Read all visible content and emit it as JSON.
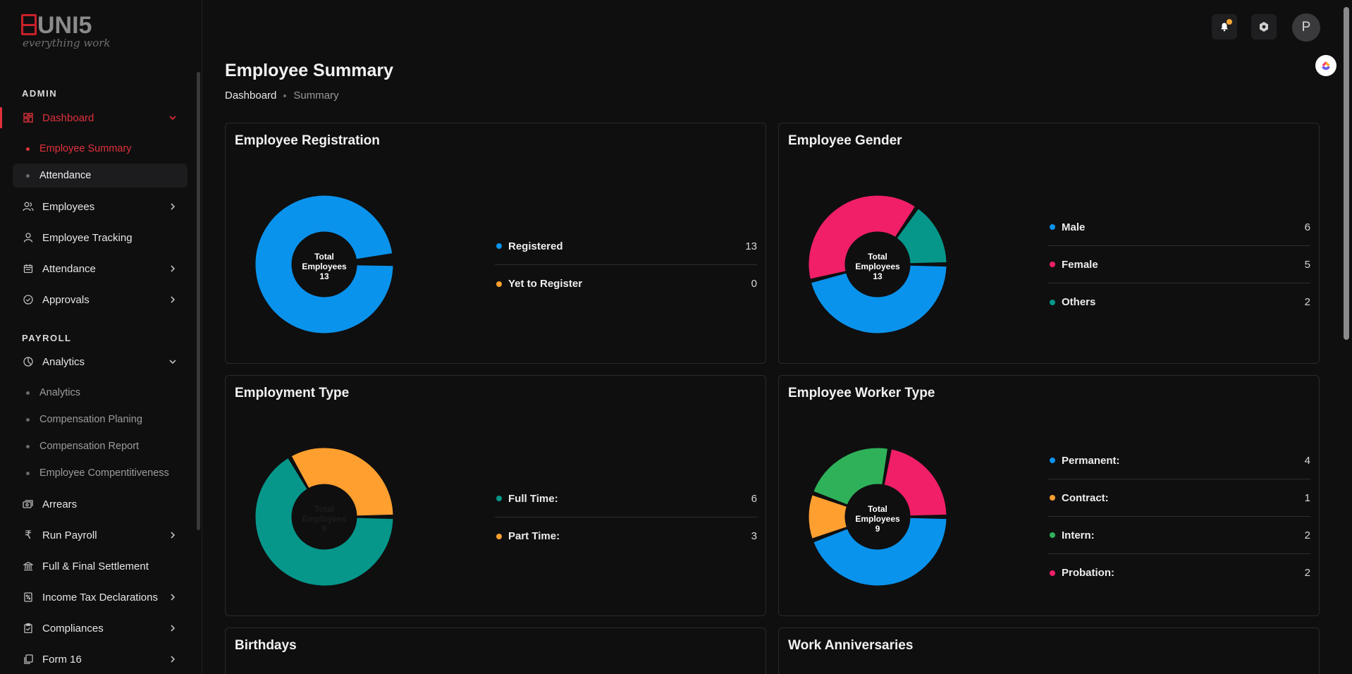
{
  "brand": {
    "name": "UNI5",
    "tagline": "everything work"
  },
  "sidebar": {
    "admin_label": "ADMIN",
    "payroll_label": "PAYROLL",
    "dashboard": "Dashboard",
    "dashboard_sub": [
      "Employee Summary",
      "Attendance"
    ],
    "admin_items": [
      "Employees",
      "Employee Tracking",
      "Attendance",
      "Approvals"
    ],
    "analytics": "Analytics",
    "analytics_sub": [
      "Analytics",
      "Compensation Planing",
      "Compensation Report",
      "Employee Compentitiveness"
    ],
    "payroll_items": [
      "Arrears",
      "Run Payroll",
      "Full & Final Settlement",
      "Income Tax Declarations",
      "Compliances",
      "Form 16"
    ]
  },
  "topbar": {
    "avatar_initial": "P"
  },
  "header": {
    "title": "Employee Summary",
    "breadcrumb": [
      "Dashboard",
      "Summary"
    ]
  },
  "colors": {
    "blue": "#0a93ec",
    "orange": "#ff9f2f",
    "teal": "#06978a",
    "pink": "#f01f67",
    "green": "#2fb15a",
    "accent": "#e0313b"
  },
  "cards": {
    "registration": {
      "title": "Employee Registration",
      "center": [
        "Total",
        "Employees",
        "13"
      ],
      "legend": [
        {
          "label": "Registered",
          "value": "13"
        },
        {
          "label": "Yet to Register",
          "value": "0"
        }
      ]
    },
    "gender": {
      "title": "Employee Gender",
      "center": [
        "Total",
        "Employees",
        "13"
      ],
      "legend": [
        {
          "label": "Male",
          "value": "6"
        },
        {
          "label": "Female",
          "value": "5"
        },
        {
          "label": "Others",
          "value": "2"
        }
      ]
    },
    "employment": {
      "title": "Employment Type",
      "center": [
        "Total",
        "Employees",
        "9"
      ],
      "legend": [
        {
          "label": "Full Time:",
          "value": "6"
        },
        {
          "label": "Part Time:",
          "value": "3"
        }
      ]
    },
    "worker": {
      "title": "Employee Worker Type",
      "center": [
        "Total",
        "Employees",
        "9"
      ],
      "legend": [
        {
          "label": "Permanent:",
          "value": "4"
        },
        {
          "label": "Contract:",
          "value": "1"
        },
        {
          "label": "Intern:",
          "value": "2"
        },
        {
          "label": "Probation:",
          "value": "2"
        }
      ]
    },
    "birthdays": {
      "title": "Birthdays"
    },
    "anniversaries": {
      "title": "Work Anniversaries"
    }
  },
  "chart_data": [
    {
      "type": "pie",
      "title": "Employee Registration",
      "categories": [
        "Registered",
        "Yet to Register"
      ],
      "values": [
        13,
        0
      ],
      "colors": [
        "#0a93ec",
        "#ff9f2f"
      ]
    },
    {
      "type": "pie",
      "title": "Employee Gender",
      "categories": [
        "Male",
        "Female",
        "Others"
      ],
      "values": [
        6,
        5,
        2
      ],
      "colors": [
        "#0a93ec",
        "#f01f67",
        "#06978a"
      ]
    },
    {
      "type": "pie",
      "title": "Employment Type",
      "categories": [
        "Full Time:",
        "Part Time:"
      ],
      "values": [
        6,
        3
      ],
      "colors": [
        "#06978a",
        "#ff9f2f"
      ]
    },
    {
      "type": "pie",
      "title": "Employee Worker Type",
      "categories": [
        "Permanent:",
        "Contract:",
        "Intern:",
        "Probation:"
      ],
      "values": [
        4,
        1,
        2,
        2
      ],
      "colors": [
        "#0a93ec",
        "#ff9f2f",
        "#2fb15a",
        "#f01f67"
      ]
    }
  ]
}
